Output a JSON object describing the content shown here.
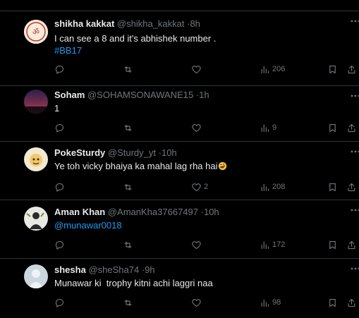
{
  "tweets": [
    {
      "name": "shikha kakkat",
      "handle": "@shikha_kakkat",
      "time": "8h",
      "text": "I can see a 8 and it's abhishek number .",
      "hashtag": "#BB17",
      "replies": "",
      "retweets": "",
      "likes": "",
      "views": "206",
      "avatar": "avatar-shikha"
    },
    {
      "name": "Soham",
      "handle": "@SOHAMSONAWANE15",
      "time": "1h",
      "text": "1",
      "replies": "",
      "retweets": "",
      "likes": "",
      "views": "9",
      "avatar": "avatar-soham"
    },
    {
      "name": "PokeSturdy",
      "handle": "@Sturdy_yt",
      "time": "10h",
      "text": "Ye toh vicky bhaiya ka mahal lag rha hai",
      "emoji": "rolling-laughing-emoji",
      "replies": "",
      "retweets": "",
      "likes": "2",
      "views": "208",
      "avatar": "avatar-pokesturdy"
    },
    {
      "name": "Aman Khan",
      "handle": "@AmanKha37667497",
      "time": "10h",
      "mention": "@munawar0018",
      "replies": "",
      "retweets": "",
      "likes": "",
      "views": "172",
      "avatar": "avatar-aman"
    },
    {
      "name": "shesha",
      "handle": "@sheSha74",
      "time": "9h",
      "text": "Munawar ki  trophy kitni achi laggri naa",
      "replies": "",
      "retweets": "",
      "likes": "",
      "views": "98",
      "avatar": "default-avatar"
    }
  ],
  "separator": "·",
  "icons": {
    "reply": "reply-icon",
    "retweet": "retweet-icon",
    "like": "heart-icon",
    "views": "views-icon",
    "bookmark": "bookmark-icon",
    "share": "share-icon",
    "more": "more-icon"
  },
  "colors": {
    "background": "#000000",
    "text": "#e7e9ea",
    "muted": "#71767b",
    "link": "#1d9bf0",
    "divider": "#2f3336"
  }
}
